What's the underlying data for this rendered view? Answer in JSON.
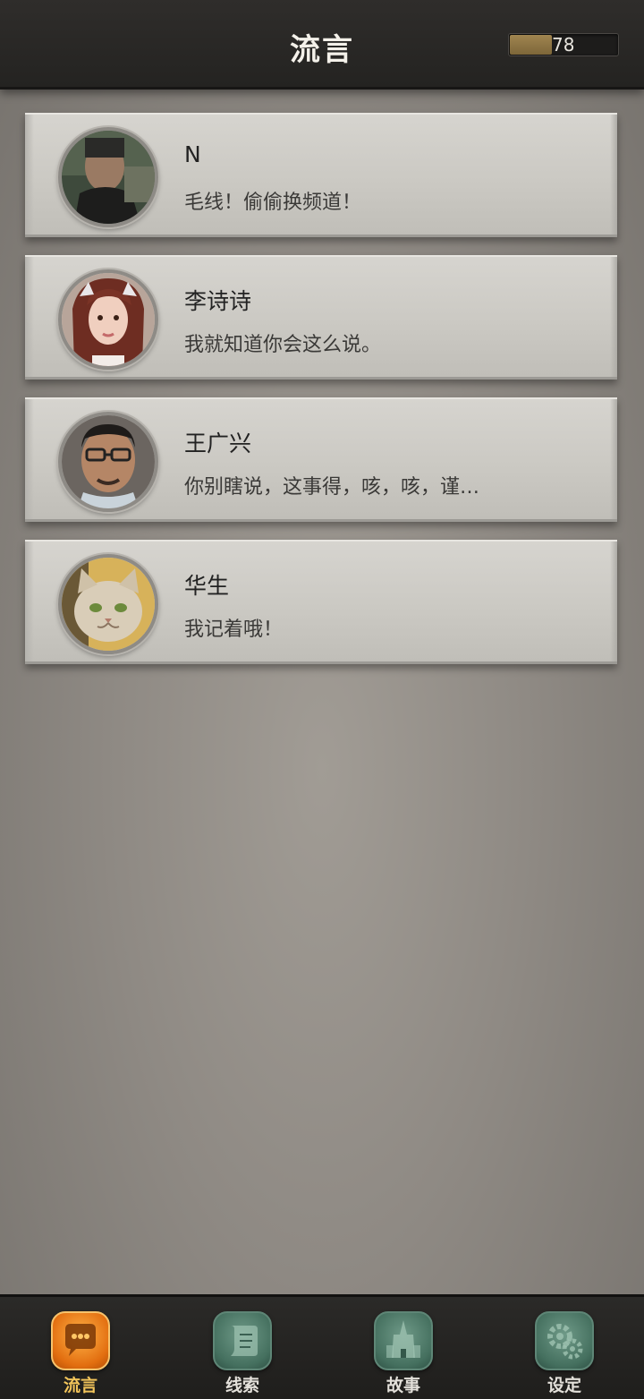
{
  "header": {
    "title": "流言",
    "energy": {
      "value": "78",
      "level": 0.39
    }
  },
  "rumors": [
    {
      "name": "N",
      "message": "毛线！偷偷换频道！",
      "avatar": "masked-man-avatar"
    },
    {
      "name": "李诗诗",
      "message": "我就知道你会这么说。",
      "avatar": "girl-with-brown-hair-avatar"
    },
    {
      "name": "王广兴",
      "message": "你别瞎说，这事得，咳，咳，谨…",
      "avatar": "man-with-glasses-avatar"
    },
    {
      "name": "华生",
      "message": "我记着哦！",
      "avatar": "cat-avatar"
    }
  ],
  "tabs": [
    {
      "label": "流言",
      "icon": "chat-bubble-icon",
      "active": true
    },
    {
      "label": "线索",
      "icon": "scroll-icon",
      "active": false
    },
    {
      "label": "故事",
      "icon": "castle-icon",
      "active": false
    },
    {
      "label": "设定",
      "icon": "gear-icon",
      "active": false
    }
  ],
  "colors": {
    "active_tab": "#f2c45a",
    "inactive_tab_icon": "#45705f",
    "energy_fill": "#a08550"
  }
}
